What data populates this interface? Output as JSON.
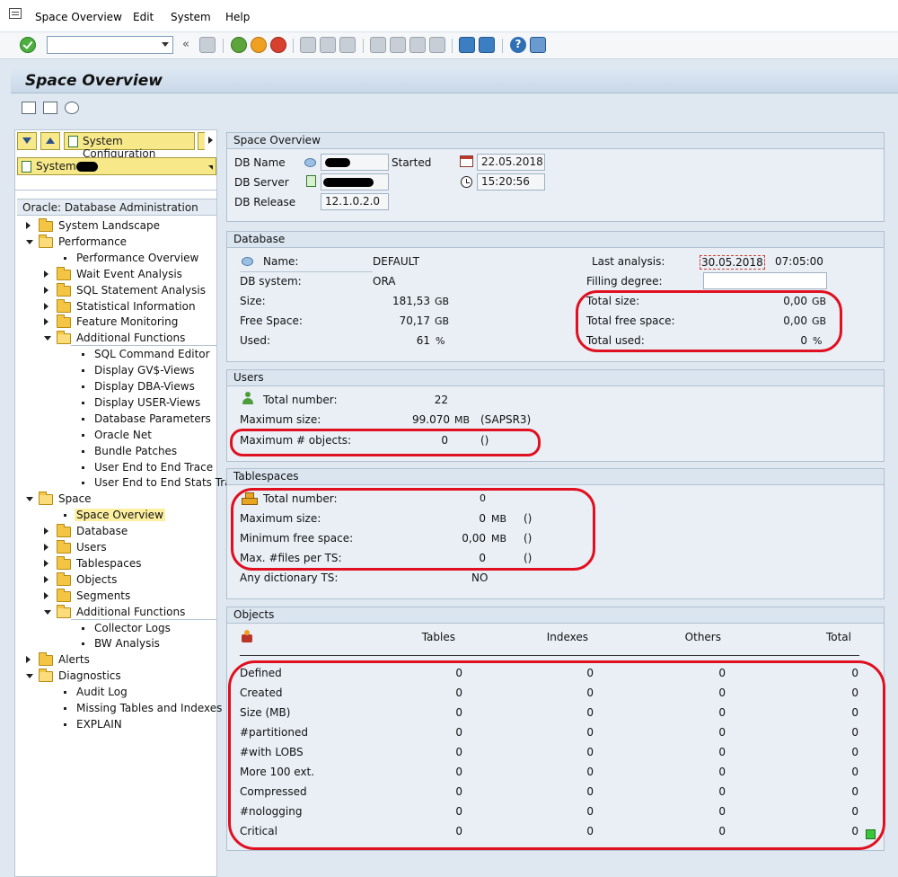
{
  "menubar": {
    "items": [
      "Space Overview",
      "Edit",
      "System",
      "Help"
    ]
  },
  "toolbar": {
    "command_field_value": "",
    "icons": [
      "enter-icon",
      "save-icon",
      "back-icon",
      "exit-icon",
      "cancel-icon",
      "print-icon",
      "find-icon",
      "find-next-icon",
      "first-page-icon",
      "previous-page-icon",
      "next-page-icon",
      "last-page-icon",
      "new-session-icon",
      "shortcut-icon",
      "help-icon",
      "customize-layout-icon"
    ]
  },
  "title": "Space Overview",
  "left_panel": {
    "button_label": "System Configuration",
    "system_field": "System",
    "tree_header": "Oracle: Database Administration",
    "tree": [
      {
        "label": "System Landscape",
        "type": "folder",
        "state": "collapsed",
        "level": 0
      },
      {
        "label": "Performance",
        "type": "folder",
        "state": "expanded",
        "level": 0
      },
      {
        "label": "Performance Overview",
        "type": "leaf",
        "level": 1
      },
      {
        "label": "Wait Event Analysis",
        "type": "folder",
        "state": "collapsed",
        "level": 1
      },
      {
        "label": "SQL Statement Analysis",
        "type": "folder",
        "state": "collapsed",
        "level": 1
      },
      {
        "label": "Statistical Information",
        "type": "folder",
        "state": "collapsed",
        "level": 1
      },
      {
        "label": "Feature Monitoring",
        "type": "folder",
        "state": "collapsed",
        "level": 1
      },
      {
        "label": "Additional Functions",
        "type": "folder",
        "state": "expanded",
        "level": 1
      },
      {
        "label": "SQL Command Editor",
        "type": "leaf",
        "level": 2
      },
      {
        "label": "Display GV$-Views",
        "type": "leaf",
        "level": 2
      },
      {
        "label": "Display DBA-Views",
        "type": "leaf",
        "level": 2
      },
      {
        "label": "Display USER-Views",
        "type": "leaf",
        "level": 2
      },
      {
        "label": "Database Parameters",
        "type": "leaf",
        "level": 2
      },
      {
        "label": "Oracle Net",
        "type": "leaf",
        "level": 2
      },
      {
        "label": "Bundle Patches",
        "type": "leaf",
        "level": 2
      },
      {
        "label": "User End to End Trace",
        "type": "leaf",
        "level": 2
      },
      {
        "label": "User End to End Stats Trace",
        "type": "leaf",
        "level": 2
      },
      {
        "label": "Space",
        "type": "folder",
        "state": "expanded",
        "level": 0
      },
      {
        "label": "Space Overview",
        "type": "leaf",
        "level": 1,
        "selected": true
      },
      {
        "label": "Database",
        "type": "folder",
        "state": "collapsed",
        "level": 1
      },
      {
        "label": "Users",
        "type": "folder",
        "state": "collapsed",
        "level": 1
      },
      {
        "label": "Tablespaces",
        "type": "folder",
        "state": "collapsed",
        "level": 1
      },
      {
        "label": "Objects",
        "type": "folder",
        "state": "collapsed",
        "level": 1
      },
      {
        "label": "Segments",
        "type": "folder",
        "state": "collapsed",
        "level": 1
      },
      {
        "label": "Additional Functions",
        "type": "folder",
        "state": "expanded",
        "level": 1
      },
      {
        "label": "Collector Logs",
        "type": "leaf",
        "level": 2
      },
      {
        "label": "BW Analysis",
        "type": "leaf",
        "level": 2
      },
      {
        "label": "Alerts",
        "type": "folder",
        "state": "collapsed",
        "level": 0
      },
      {
        "label": "Diagnostics",
        "type": "folder",
        "state": "expanded",
        "level": 0
      },
      {
        "label": "Audit Log",
        "type": "leaf",
        "level": 1
      },
      {
        "label": "Missing Tables and Indexes",
        "type": "leaf",
        "level": 1
      },
      {
        "label": "EXPLAIN",
        "type": "leaf",
        "level": 1
      }
    ]
  },
  "space_overview": {
    "title": "Space Overview",
    "db_name_label": "DB Name",
    "db_server_label": "DB Server",
    "db_release_label": "DB Release",
    "db_release_value": "12.1.0.2.0",
    "started_label": "Started",
    "started_date": "22.05.2018",
    "started_time": "15:20:56"
  },
  "database": {
    "title": "Database",
    "name_label": "Name:",
    "name_value": "DEFAULT",
    "db_system_label": "DB system:",
    "db_system_value": "ORA",
    "size_label": "Size:",
    "size_value": "181,53",
    "size_unit": "GB",
    "free_label": "Free Space:",
    "free_value": "70,17",
    "free_unit": "GB",
    "used_label": "Used:",
    "used_value": "61",
    "used_unit": "%",
    "last_analysis_label": "Last analysis:",
    "last_analysis_date": "30.05.2018",
    "last_analysis_time": "07:05:00",
    "filling_label": "Filling degree:",
    "total_size_label": "Total size:",
    "total_size_value": "0,00",
    "total_size_unit": "GB",
    "total_free_label": "Total free space:",
    "total_free_value": "0,00",
    "total_free_unit": "GB",
    "total_used_label": "Total used:",
    "total_used_value": "0",
    "total_used_unit": "%"
  },
  "users": {
    "title": "Users",
    "total_label": "Total number:",
    "total_value": "22",
    "max_size_label": "Maximum size:",
    "max_size_value": "99.070",
    "max_size_unit": "MB",
    "max_size_owner": "(SAPSR3)",
    "max_objects_label": "Maximum # objects:",
    "max_objects_value": "0",
    "max_objects_owner": "()"
  },
  "tablespaces": {
    "title": "Tablespaces",
    "total_label": "Total number:",
    "total_value": "0",
    "max_size_label": "Maximum size:",
    "max_size_value": "0",
    "max_size_unit": "MB",
    "max_size_owner": "()",
    "min_free_label": "Minimum free space:",
    "min_free_value": "0,00",
    "min_free_unit": "MB",
    "min_free_owner": "()",
    "max_files_label": "Max. #files per TS:",
    "max_files_value": "0",
    "max_files_owner": "()",
    "dict_label": "Any dictionary TS:",
    "dict_value": "NO"
  },
  "objects": {
    "title": "Objects",
    "columns": [
      "Tables",
      "Indexes",
      "Others",
      "Total"
    ],
    "rows": [
      {
        "label": "Defined",
        "values": [
          "0",
          "0",
          "0",
          "0"
        ]
      },
      {
        "label": "Created",
        "values": [
          "0",
          "0",
          "0",
          "0"
        ]
      },
      {
        "label": "Size (MB)",
        "values": [
          "0",
          "0",
          "0",
          "0"
        ]
      },
      {
        "label": "#partitioned",
        "values": [
          "0",
          "0",
          "0",
          "0"
        ]
      },
      {
        "label": "#with LOBS",
        "values": [
          "0",
          "0",
          "0",
          "0"
        ]
      },
      {
        "label": "More 100 ext.",
        "values": [
          "0",
          "0",
          "0",
          "0"
        ]
      },
      {
        "label": "Compressed",
        "values": [
          "0",
          "0",
          "0",
          "0"
        ]
      },
      {
        "label": "#nologging",
        "values": [
          "0",
          "0",
          "0",
          "0"
        ]
      },
      {
        "label": "Critical",
        "values": [
          "0",
          "0",
          "0",
          "0"
        ]
      }
    ],
    "critical_status_color": "#3ac43a"
  },
  "colors": {
    "highlight_ellipse": "#e01020",
    "selected_node": "#fcefa0",
    "background": "#dfe8f1"
  }
}
